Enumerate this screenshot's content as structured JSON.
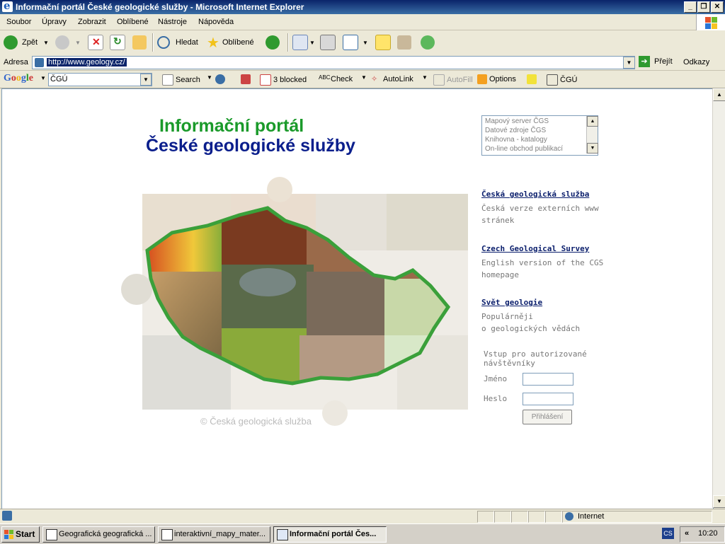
{
  "window": {
    "title": "Informační portál České geologické služby - Microsoft Internet Explorer",
    "min": "_",
    "max": "❐",
    "close": "✕"
  },
  "menu": [
    "Soubor",
    "Úpravy",
    "Zobrazit",
    "Oblíbené",
    "Nástroje",
    "Nápověda"
  ],
  "toolbar": {
    "back": "Zpět",
    "search": "Hledat",
    "favorites": "Oblíbené"
  },
  "address": {
    "label": "Adresa",
    "url": "http://www.geology.cz/",
    "go": "Přejít",
    "links": "Odkazy"
  },
  "google": {
    "logo": "Google",
    "query": "ČGÚ",
    "search": "Search",
    "blocked": "3 blocked",
    "check": "Check",
    "autolink": "AutoLink",
    "autofill": "AutoFill",
    "options": "Options",
    "cgu": "ČGÚ"
  },
  "page": {
    "title_line1": "Informační portál",
    "title_line2": "České geologické služby",
    "listbox_options": [
      "Mapový server ČGS",
      "Datové zdroje ČGS",
      "Knihovna - katalogy",
      "On-line obchod publikací"
    ],
    "copyright": "© Česká geologická služba",
    "links": [
      {
        "label": "Česká geologická služba",
        "desc1": "Česká verze externích www",
        "desc2": "stránek"
      },
      {
        "label": "Czech Geological Survey",
        "desc1": "English version of the CGS",
        "desc2": "homepage"
      },
      {
        "label": "Svět geologie",
        "desc1": "Populárněji",
        "desc2": "o geologických vědách"
      }
    ],
    "login": {
      "title1": "Vstup pro autorizované",
      "title2": "návštěvníky",
      "name_label": "Jméno",
      "pass_label": "Heslo",
      "button": "Přihlášení"
    }
  },
  "status": {
    "zone": "Internet"
  },
  "taskbar": {
    "start": "Start",
    "tasks": [
      "Geografická geografická ...",
      "interaktivní_mapy_mater...",
      "Informační portál Čes..."
    ],
    "lang": "CS",
    "clock": "10:20",
    "chevron": "«"
  }
}
